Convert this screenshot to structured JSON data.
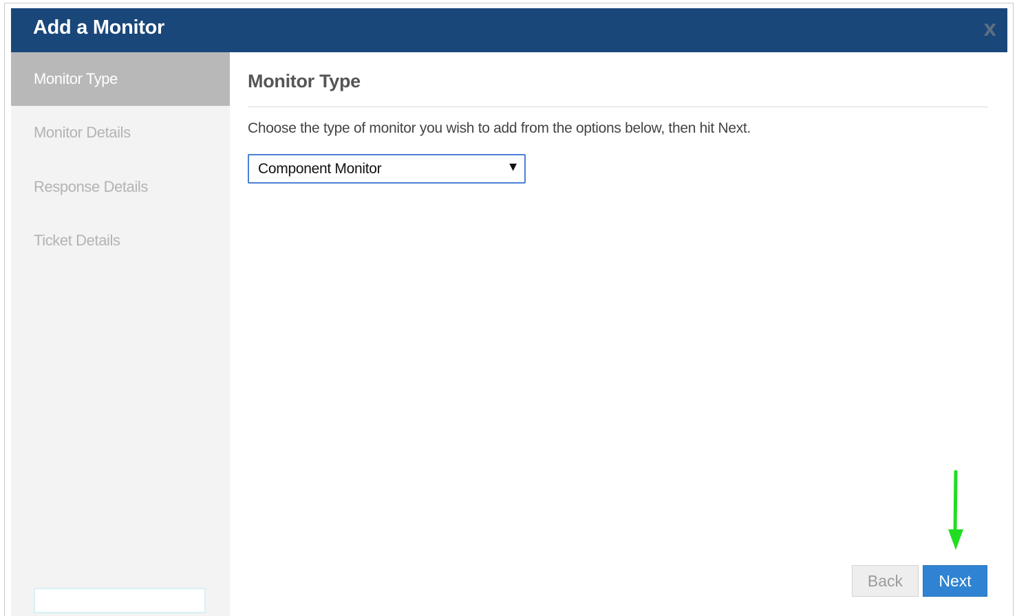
{
  "dialog": {
    "title": "Add a Monitor",
    "close_label": "X"
  },
  "sidebar": {
    "items": [
      {
        "label": "Monitor Type",
        "active": true
      },
      {
        "label": "Monitor Details",
        "active": false
      },
      {
        "label": "Response Details",
        "active": false
      },
      {
        "label": "Ticket Details",
        "active": false
      }
    ]
  },
  "main": {
    "heading": "Monitor Type",
    "instruction": "Choose the type of monitor you wish to add from the options below, then hit Next.",
    "monitor_type_select": {
      "selected": "Component Monitor"
    }
  },
  "footer": {
    "back_label": "Back",
    "next_label": "Next"
  },
  "colors": {
    "title_bar": "#1a477a",
    "active_step": "#b8b8b8",
    "primary_button": "#2f83d2",
    "annotation_arrow": "#22dd22"
  },
  "icons": {
    "close": "close-icon",
    "dropdown": "chevron-down-icon",
    "annotation": "arrow-down-icon"
  }
}
